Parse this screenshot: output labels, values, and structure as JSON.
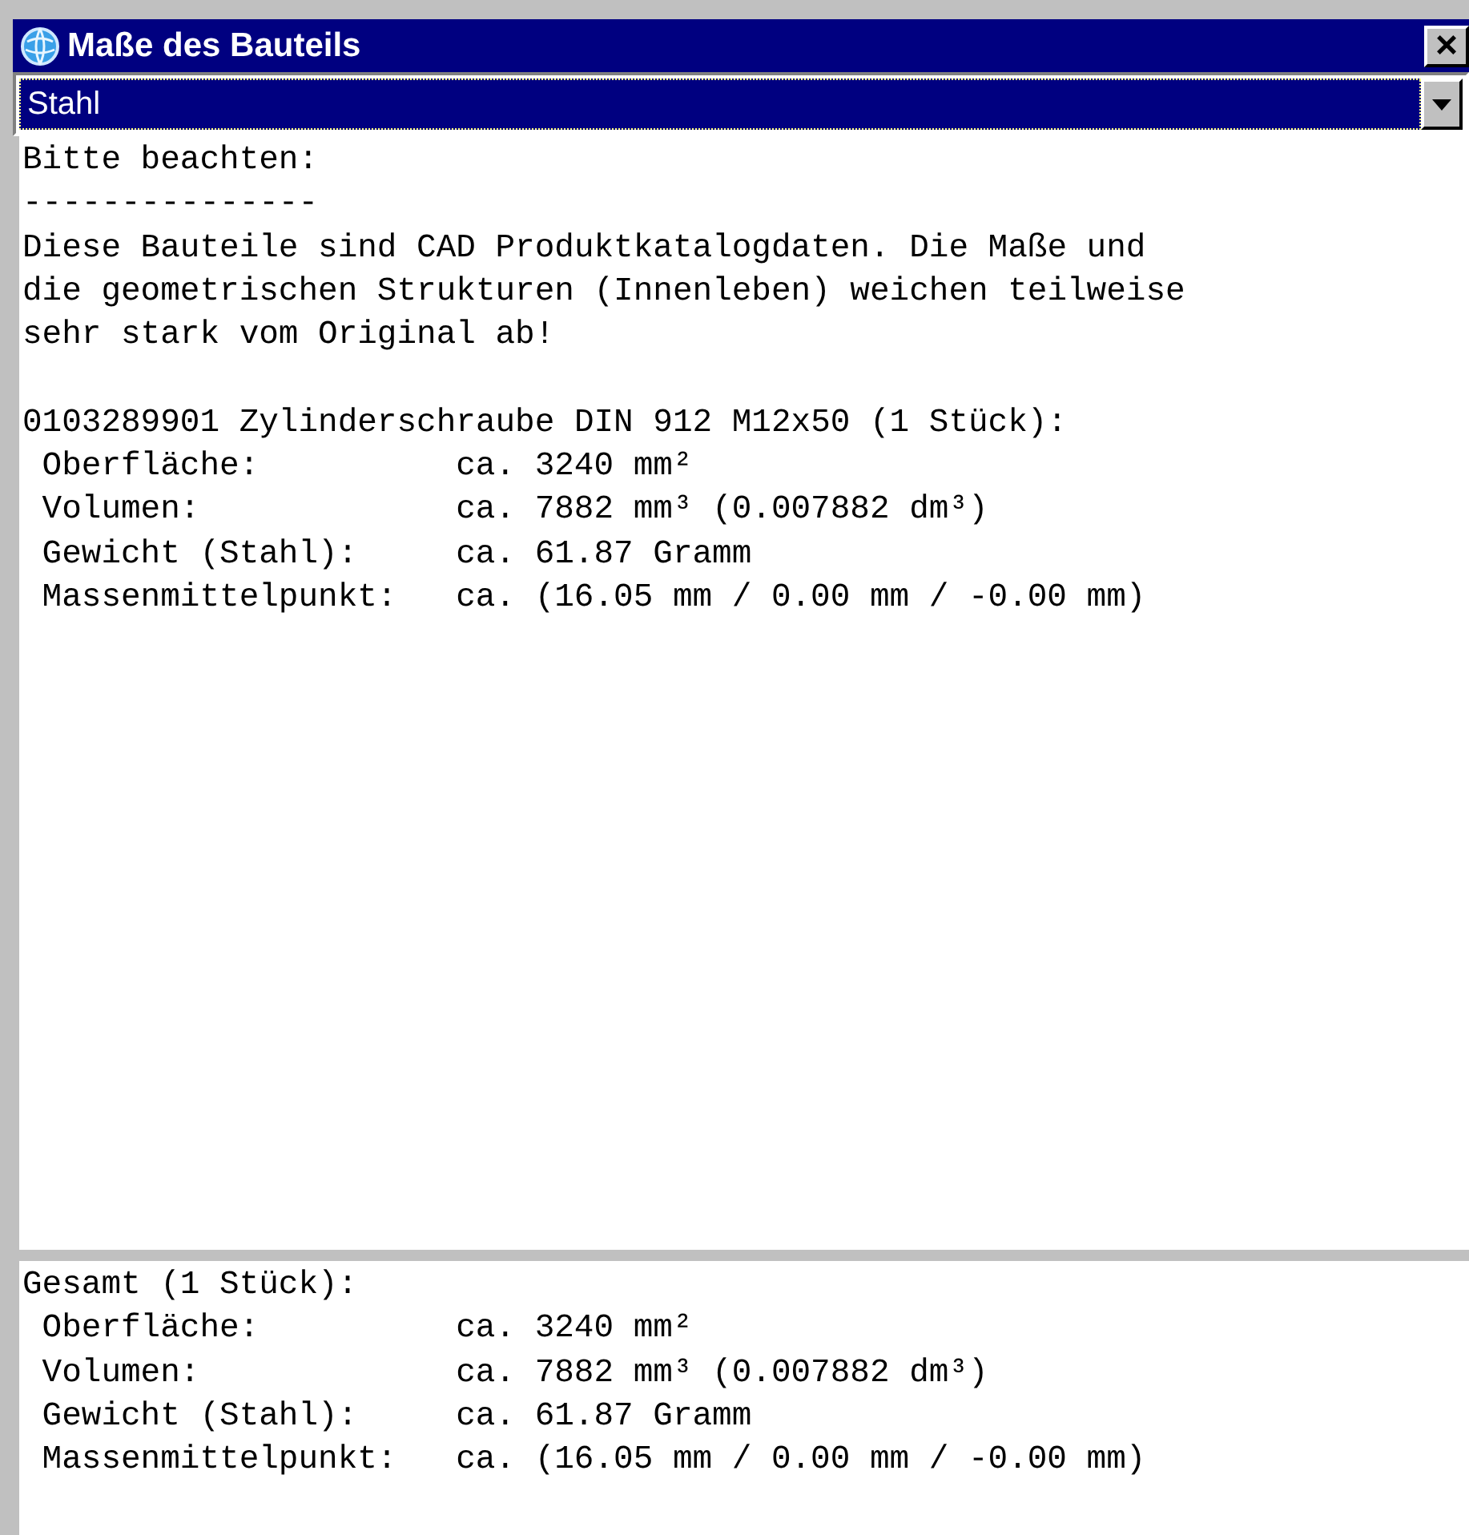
{
  "window": {
    "title": "Maße des Bauteils",
    "close": "×"
  },
  "material_select": {
    "value": "Stahl",
    "selected": true
  },
  "notice": {
    "heading": "Bitte beachten:",
    "rule": "---------------",
    "lines": [
      "Diese Bauteile sind CAD Produktkatalogdaten. Die Maße und",
      "die geometrischen Strukturen (Innenleben) weichen teilweise",
      "sehr stark vom Original ab!"
    ]
  },
  "part": {
    "header": "0103289901 Zylinderschraube DIN 912 M12x50 (1 Stück):",
    "properties": [
      {
        "label": "Oberfläche:",
        "value": "ca. 3240 mm²"
      },
      {
        "label": "Volumen:",
        "value": "ca. 7882 mm³ (0.007882 dm³)"
      },
      {
        "label": "Gewicht (Stahl):",
        "value": "ca. 61.87 Gramm"
      },
      {
        "label": "Massenmittelpunkt:",
        "value": "ca. (16.05 mm / 0.00 mm / -0.00 mm)"
      }
    ]
  },
  "total": {
    "header": "Gesamt (1 Stück):",
    "properties": [
      {
        "label": "Oberfläche:",
        "value": "ca. 3240 mm²"
      },
      {
        "label": "Volumen:",
        "value": "ca. 7882 mm³ (0.007882 dm³)"
      },
      {
        "label": "Gewicht (Stahl):",
        "value": "ca. 61.87 Gramm"
      },
      {
        "label": "Massenmittelpunkt:",
        "value": "ca. (16.05 mm / 0.00 mm / -0.00 mm)"
      }
    ]
  }
}
